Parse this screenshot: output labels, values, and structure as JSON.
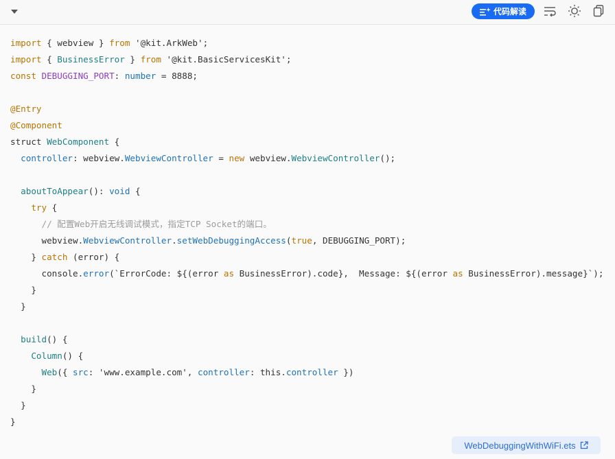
{
  "toolbar": {
    "explain_label": "代码解读",
    "icons": [
      "collapse-caret-icon",
      "sparkle-icon",
      "wrap-lines-icon",
      "theme-sun-icon",
      "copy-icon"
    ]
  },
  "code": {
    "lines": [
      [
        {
          "t": "import",
          "c": "kw"
        },
        {
          "t": " { webview } ",
          "c": "st"
        },
        {
          "t": "from",
          "c": "kw"
        },
        {
          "t": " '@kit.ArkWeb';",
          "c": "st"
        }
      ],
      [
        {
          "t": "import",
          "c": "kw"
        },
        {
          "t": " { ",
          "c": "st"
        },
        {
          "t": "BusinessError",
          "c": "ty"
        },
        {
          "t": " } ",
          "c": "st"
        },
        {
          "t": "from",
          "c": "kw"
        },
        {
          "t": " '@kit.BasicServicesKit';",
          "c": "st"
        }
      ],
      [
        {
          "t": "const",
          "c": "kw"
        },
        {
          "t": " ",
          "c": "st"
        },
        {
          "t": "DEBUGGING_PORT",
          "c": "pu"
        },
        {
          "t": ": ",
          "c": "st"
        },
        {
          "t": "number",
          "c": "fn"
        },
        {
          "t": " = 8888;",
          "c": "st"
        }
      ],
      [],
      [
        {
          "t": "@Entry",
          "c": "kw"
        }
      ],
      [
        {
          "t": "@Component",
          "c": "kw"
        }
      ],
      [
        {
          "t": "struct ",
          "c": "st"
        },
        {
          "t": "WebComponent",
          "c": "ty"
        },
        {
          "t": " {",
          "c": "st"
        }
      ],
      [
        {
          "t": "  ",
          "c": "st"
        },
        {
          "t": "controller",
          "c": "fn"
        },
        {
          "t": ": webview.",
          "c": "st"
        },
        {
          "t": "WebviewController",
          "c": "fn"
        },
        {
          "t": " = ",
          "c": "st"
        },
        {
          "t": "new",
          "c": "kw"
        },
        {
          "t": " webview.",
          "c": "st"
        },
        {
          "t": "WebviewController",
          "c": "ty"
        },
        {
          "t": "();",
          "c": "st"
        }
      ],
      [],
      [
        {
          "t": "  ",
          "c": "st"
        },
        {
          "t": "aboutToAppear",
          "c": "ty"
        },
        {
          "t": "(): ",
          "c": "st"
        },
        {
          "t": "void",
          "c": "fn"
        },
        {
          "t": " {",
          "c": "st"
        }
      ],
      [
        {
          "t": "    ",
          "c": "st"
        },
        {
          "t": "try",
          "c": "kw"
        },
        {
          "t": " {",
          "c": "st"
        }
      ],
      [
        {
          "t": "      // 配置Web开启无线调试模式，指定TCP Socket的端口。",
          "c": "cm"
        }
      ],
      [
        {
          "t": "      webview.",
          "c": "st"
        },
        {
          "t": "WebviewController",
          "c": "fn"
        },
        {
          "t": ".",
          "c": "st"
        },
        {
          "t": "setWebDebuggingAccess",
          "c": "fn"
        },
        {
          "t": "(",
          "c": "st"
        },
        {
          "t": "true",
          "c": "kw"
        },
        {
          "t": ", DEBUGGING_PORT);",
          "c": "st"
        }
      ],
      [
        {
          "t": "    } ",
          "c": "st"
        },
        {
          "t": "catch",
          "c": "kw"
        },
        {
          "t": " (error) {",
          "c": "st"
        }
      ],
      [
        {
          "t": "      console.",
          "c": "st"
        },
        {
          "t": "error",
          "c": "fn"
        },
        {
          "t": "(`ErrorCode: ${(error ",
          "c": "st"
        },
        {
          "t": "as",
          "c": "kw"
        },
        {
          "t": " BusinessError).code},  Message: ${(error ",
          "c": "st"
        },
        {
          "t": "as",
          "c": "kw"
        },
        {
          "t": " BusinessError).message}`);",
          "c": "st"
        }
      ],
      [
        {
          "t": "    }",
          "c": "st"
        }
      ],
      [
        {
          "t": "  }",
          "c": "st"
        }
      ],
      [],
      [
        {
          "t": "  ",
          "c": "st"
        },
        {
          "t": "build",
          "c": "ty"
        },
        {
          "t": "() {",
          "c": "st"
        }
      ],
      [
        {
          "t": "    ",
          "c": "st"
        },
        {
          "t": "Column",
          "c": "ty"
        },
        {
          "t": "() {",
          "c": "st"
        }
      ],
      [
        {
          "t": "      ",
          "c": "st"
        },
        {
          "t": "Web",
          "c": "ty"
        },
        {
          "t": "({ ",
          "c": "st"
        },
        {
          "t": "src",
          "c": "fn"
        },
        {
          "t": ": 'www.example.com', ",
          "c": "st"
        },
        {
          "t": "controller",
          "c": "fn"
        },
        {
          "t": ": this.",
          "c": "st"
        },
        {
          "t": "controller",
          "c": "fn"
        },
        {
          "t": " })",
          "c": "st"
        }
      ],
      [
        {
          "t": "    }",
          "c": "st"
        }
      ],
      [
        {
          "t": "  }",
          "c": "st"
        }
      ],
      [
        {
          "t": "}",
          "c": "st"
        }
      ]
    ]
  },
  "file": {
    "name": "WebDebuggingWithWiFi.ets",
    "icon": "external-link-icon"
  },
  "colors": {
    "accent": "#1a6bf3",
    "keyword": "#b87400",
    "type": "#1d7f84",
    "function": "#1f72b5",
    "comment": "#9b9b9b"
  }
}
